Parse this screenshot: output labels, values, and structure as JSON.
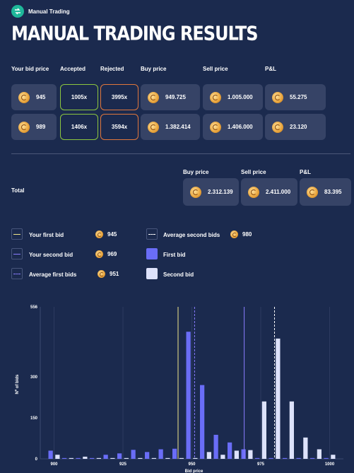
{
  "app": {
    "name": "Manual Trading",
    "title": "MANUAL TRADING RESULTS"
  },
  "columns": {
    "bid": "Your bid price",
    "accepted": "Accepted",
    "rejected": "Rejected",
    "buy": "Buy price",
    "sell": "Sell price",
    "pnl": "P&L"
  },
  "rows": [
    {
      "bid": "945",
      "accepted": "1005x",
      "rejected": "3995x",
      "buy": "949.725",
      "sell": "1.005.000",
      "pnl": "55.275"
    },
    {
      "bid": "989",
      "accepted": "1406x",
      "rejected": "3594x",
      "buy": "1.382.414",
      "sell": "1.406.000",
      "pnl": "23.120"
    }
  ],
  "total": {
    "label": "Total",
    "buy_label": "Buy price",
    "sell_label": "Sell price",
    "pnl_label": "P&L",
    "buy": "2.312.139",
    "sell": "2.411.000",
    "pnl": "83.395"
  },
  "legend": {
    "first_bid": "Your first bid",
    "first_bid_val": "945",
    "second_bid": "Your second bid",
    "second_bid_val": "969",
    "avg_first": "Average first bids",
    "avg_first_val": "951",
    "avg_second": "Average second bids",
    "avg_second_val": "980",
    "first_bar": "First bid",
    "second_bar": "Second bid"
  },
  "colors": {
    "background": "#1b2a4e",
    "card": "#364366",
    "accepted": "#8cc63f",
    "rejected": "#e0773c",
    "first": "#6a6df7",
    "second": "#dde2fb",
    "first_line": "#f0e68a",
    "second_line": "#8a7cff",
    "logo": "#1fb89a"
  },
  "chart_data": {
    "type": "bar",
    "xlabel": "Bid price",
    "ylabel": "Nº of bids",
    "xlim": [
      895,
      1005
    ],
    "ylim": [
      0,
      556
    ],
    "xticks": [
      900,
      925,
      950,
      975,
      1000
    ],
    "yticks": [
      0,
      150,
      300,
      556
    ],
    "bin_width": 5,
    "categories": [
      900,
      905,
      910,
      915,
      920,
      925,
      930,
      935,
      940,
      945,
      950,
      955,
      960,
      965,
      970,
      975,
      980,
      985,
      990,
      995,
      1000
    ],
    "series": [
      {
        "name": "First bid",
        "values": [
          30,
          3,
          3,
          3,
          15,
          20,
          33,
          25,
          35,
          37,
          465,
          270,
          88,
          60,
          35,
          3,
          3,
          3,
          3,
          3,
          3
        ]
      },
      {
        "name": "Second bid",
        "values": [
          15,
          3,
          8,
          3,
          3,
          3,
          3,
          3,
          3,
          3,
          3,
          25,
          15,
          30,
          32,
          210,
          440,
          210,
          78,
          35,
          15
        ]
      }
    ],
    "lines": [
      {
        "name": "Your first bid",
        "x": 945,
        "style": "solid"
      },
      {
        "name": "Your second bid",
        "x": 969,
        "style": "solid"
      },
      {
        "name": "Average first bids",
        "x": 951,
        "style": "dashed"
      },
      {
        "name": "Average second bids",
        "x": 980,
        "style": "dashed"
      }
    ]
  }
}
